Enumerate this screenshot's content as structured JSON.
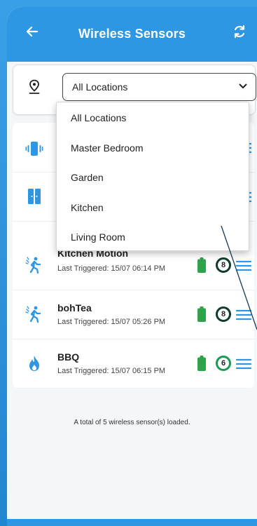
{
  "header": {
    "title": "Wireless Sensors"
  },
  "filter": {
    "selected": "All Locations"
  },
  "dropdown": {
    "options": [
      "All Locations",
      "Master Bedroom",
      "Garden",
      "Kitchen",
      "Living Room"
    ]
  },
  "sensors": [
    {
      "name": "",
      "last_triggered": "",
      "icon": "vibration-icon",
      "badge": ""
    },
    {
      "name": "",
      "last_triggered": "",
      "icon": "door-sensor-icon",
      "badge": ""
    },
    {
      "name": "Kitchen Motion",
      "last_triggered": "Last Triggered: 15/07 06:14 PM",
      "icon": "motion-icon",
      "badge": "8"
    },
    {
      "name": "bohTea",
      "last_triggered": "Last Triggered: 15/07 05:26 PM",
      "icon": "motion-icon",
      "badge": "8"
    },
    {
      "name": "BBQ",
      "last_triggered": "Last Triggered: 15/07 06:15 PM",
      "icon": "flame-icon",
      "badge": "6"
    }
  ],
  "footer": {
    "total_text": "A total of 5 wireless sensor(s) loaded."
  },
  "colors": {
    "primary": "#2d97e4",
    "battery": "#2fa34a",
    "badge_dark": "#0f3d2d",
    "badge_green": "#1a9a55"
  }
}
